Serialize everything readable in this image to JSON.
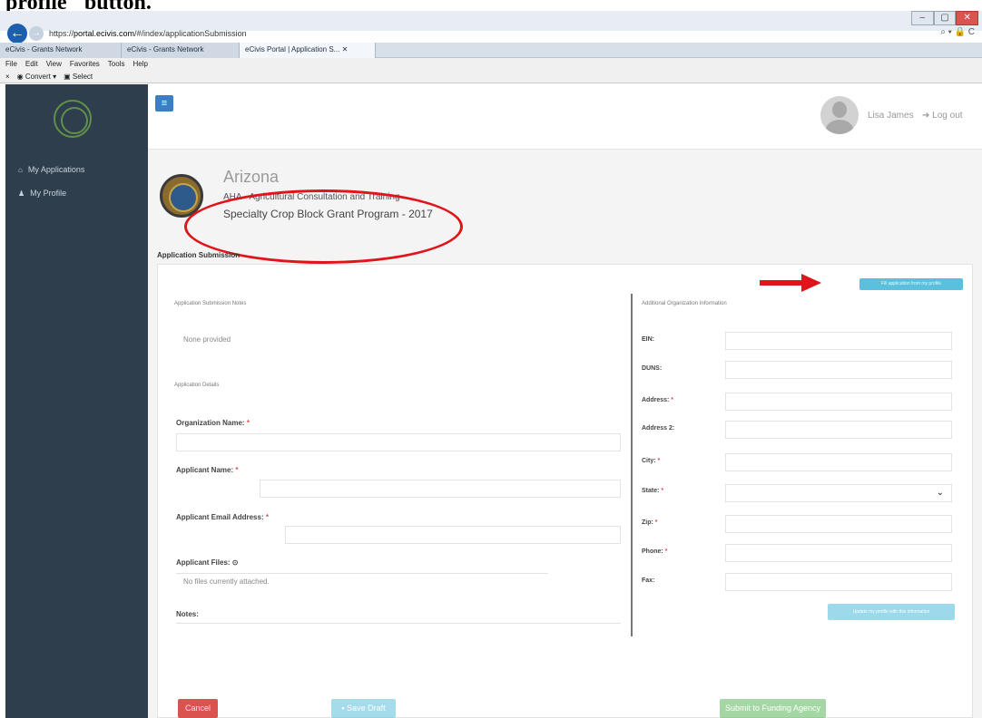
{
  "caption": "profile\" button.",
  "browser": {
    "window_controls": [
      "–",
      "▢",
      "✕"
    ],
    "url_prefix": "https://",
    "url_host": "portal.ecivis.com",
    "url_path": "/#/index/applicationSubmission",
    "address_icons": "⌕ ▾ 🔒 C",
    "tabs": [
      {
        "label": "eCivis - Grants Network"
      },
      {
        "label": "eCivis - Grants Network"
      },
      {
        "label": "eCivis Portal | Application S... ✕"
      }
    ],
    "menu": [
      "File",
      "Edit",
      "View",
      "Favorites",
      "Tools",
      "Help"
    ],
    "toolbar": {
      "close": "×",
      "convert": "Convert",
      "select": "Select"
    }
  },
  "sidebar": {
    "items": [
      {
        "icon": "home-icon",
        "label": "My Applications"
      },
      {
        "icon": "user-icon",
        "label": "My Profile"
      }
    ]
  },
  "header": {
    "menu_icon": "≡",
    "user_name": "Lisa James",
    "logout": "Log out"
  },
  "org": {
    "state": "Arizona",
    "organization": "AHA - Agricultural Consultation and Training",
    "program": "Specialty Crop Block Grant Program - 2017"
  },
  "page": {
    "section_label": "Application Submission",
    "fill_button": "Fill application from my profile"
  },
  "left": {
    "notes_heading": "Application Submission Notes",
    "notes_value": "None provided",
    "details_heading": "Application Details",
    "org_name_label": "Organization Name:",
    "applicant_name_label": "Applicant Name:",
    "applicant_email_label": "Applicant Email Address:",
    "applicant_files_label": "Applicant Files:",
    "files_value": "No files currently attached.",
    "notes_label": "Notes:",
    "required_mark": "*"
  },
  "right": {
    "heading": "Additional Organization Information",
    "ein": "EIN:",
    "duns": "DUNS:",
    "address": "Address:",
    "address2": "Address 2:",
    "city": "City:",
    "state": "State:",
    "zip": "Zip:",
    "phone": "Phone:",
    "fax": "Fax:",
    "update_button": "Update my profile with this information"
  },
  "footer": {
    "cancel": "Cancel",
    "save": "Save Draft",
    "submit": "Submit to Funding Agency"
  },
  "colors": {
    "sidebar": "#2f3e4c",
    "primary": "#3a7fc4",
    "info": "#5bc0de",
    "danger": "#d9534f",
    "success": "#5cb85c",
    "annotation": "#e0141b"
  }
}
